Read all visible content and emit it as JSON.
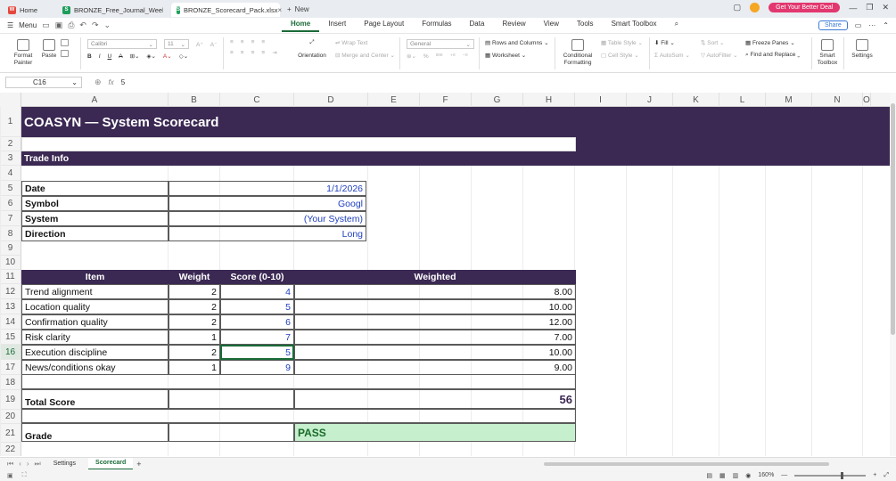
{
  "titlebar": {
    "tabs": [
      {
        "label": "Home",
        "icon": "wps-icon"
      },
      {
        "label": "BRONZE_Free_Journal_WeeklyReview",
        "icon": "sheet-icon"
      },
      {
        "label": "BRONZE_Scorecard_Pack.xlsx",
        "icon": "sheet-icon"
      }
    ],
    "new_tab": "New",
    "deal_button": "Get Your Better Deal"
  },
  "menubar": {
    "menu_label": "Menu",
    "tabs": [
      "Home",
      "Insert",
      "Page Layout",
      "Formulas",
      "Data",
      "Review",
      "View",
      "Tools",
      "Smart Toolbox"
    ],
    "active_tab": "Home",
    "share": "Share"
  },
  "ribbon": {
    "format_painter": "Format Painter",
    "paste": "Paste",
    "font_name": "Calibri",
    "font_size": "11",
    "wrap_text": "Wrap Text",
    "orientation": "Orientation",
    "merge_center": "Merge and Center",
    "number_format": "General",
    "rows_columns": "Rows and Columns",
    "worksheet": "Worksheet",
    "conditional_formatting": "Conditional Formatting",
    "table_style": "Table Style",
    "cell_style": "Cell Style",
    "fill": "Fill",
    "autosum": "AutoSum",
    "sort": "Sort",
    "autofilter": "AutoFilter",
    "freeze_panes": "Freeze Panes",
    "find_replace": "Find and Replace",
    "smart_toolbox": "Smart Toolbox",
    "settings": "Settings"
  },
  "formula_bar": {
    "cell_ref": "C16",
    "fx": "fx",
    "value": "5"
  },
  "columns": [
    "A",
    "B",
    "C",
    "D",
    "E",
    "F",
    "G",
    "H",
    "I",
    "J",
    "K",
    "L",
    "M",
    "N",
    "O"
  ],
  "rows": [
    "1",
    "2",
    "3",
    "4",
    "5",
    "6",
    "7",
    "8",
    "9",
    "10",
    "11",
    "12",
    "13",
    "14",
    "15",
    "16",
    "17",
    "18",
    "19",
    "20",
    "21",
    "22"
  ],
  "sheet": {
    "title": "COASYN — System Scorecard",
    "trade_info_header": "Trade Info",
    "trade_info": [
      {
        "label": "Date",
        "value": "1/1/2026"
      },
      {
        "label": "Symbol",
        "value": "Googl"
      },
      {
        "label": "System",
        "value": "(Your System)"
      },
      {
        "label": "Direction",
        "value": "Long"
      }
    ],
    "table_headers": {
      "item": "Item",
      "weight": "Weight",
      "score": "Score (0-10)",
      "weighted": "Weighted"
    },
    "items": [
      {
        "item": "Trend alignment",
        "weight": "2",
        "score": "4",
        "weighted": "8.00"
      },
      {
        "item": "Location quality",
        "weight": "2",
        "score": "5",
        "weighted": "10.00"
      },
      {
        "item": "Confirmation quality",
        "weight": "2",
        "score": "6",
        "weighted": "12.00"
      },
      {
        "item": "Risk clarity",
        "weight": "1",
        "score": "7",
        "weighted": "7.00"
      },
      {
        "item": "Execution discipline",
        "weight": "2",
        "score": "5",
        "weighted": "10.00"
      },
      {
        "item": "News/conditions okay",
        "weight": "1",
        "score": "9",
        "weighted": "9.00"
      }
    ],
    "total_label": "Total Score",
    "total_value": "56",
    "grade_label": "Grade",
    "grade_value": "PASS"
  },
  "sheet_tabs": [
    "Settings",
    "Scorecard"
  ],
  "active_sheet": "Scorecard",
  "status": {
    "zoom": "160%"
  },
  "colors": {
    "accent": "#1a6b38",
    "band": "#3b2853",
    "blue_value": "#1f3fbf",
    "pass_fill": "#c6efce"
  }
}
